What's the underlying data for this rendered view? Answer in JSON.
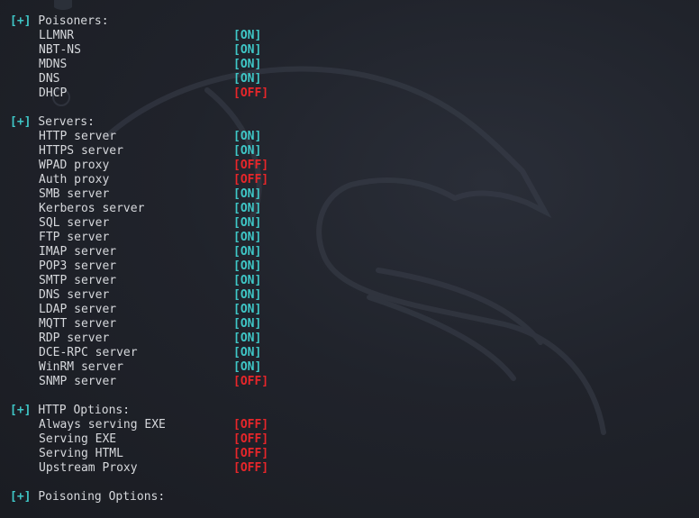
{
  "theme": {
    "on_color": "#3fc7c7",
    "off_color": "#e8262a",
    "text_color": "#d6d8dc",
    "background": "#1c1f26"
  },
  "sections": [
    {
      "marker": "[+]",
      "title": "Poisoners:",
      "items": [
        {
          "label": "LLMNR",
          "status": "[ON]"
        },
        {
          "label": "NBT-NS",
          "status": "[ON]"
        },
        {
          "label": "MDNS",
          "status": "[ON]"
        },
        {
          "label": "DNS",
          "status": "[ON]"
        },
        {
          "label": "DHCP",
          "status": "[OFF]"
        }
      ]
    },
    {
      "marker": "[+]",
      "title": "Servers:",
      "items": [
        {
          "label": "HTTP server",
          "status": "[ON]"
        },
        {
          "label": "HTTPS server",
          "status": "[ON]"
        },
        {
          "label": "WPAD proxy",
          "status": "[OFF]"
        },
        {
          "label": "Auth proxy",
          "status": "[OFF]"
        },
        {
          "label": "SMB server",
          "status": "[ON]"
        },
        {
          "label": "Kerberos server",
          "status": "[ON]"
        },
        {
          "label": "SQL server",
          "status": "[ON]"
        },
        {
          "label": "FTP server",
          "status": "[ON]"
        },
        {
          "label": "IMAP server",
          "status": "[ON]"
        },
        {
          "label": "POP3 server",
          "status": "[ON]"
        },
        {
          "label": "SMTP server",
          "status": "[ON]"
        },
        {
          "label": "DNS server",
          "status": "[ON]"
        },
        {
          "label": "LDAP server",
          "status": "[ON]"
        },
        {
          "label": "MQTT server",
          "status": "[ON]"
        },
        {
          "label": "RDP server",
          "status": "[ON]"
        },
        {
          "label": "DCE-RPC server",
          "status": "[ON]"
        },
        {
          "label": "WinRM server",
          "status": "[ON]"
        },
        {
          "label": "SNMP server",
          "status": "[OFF]"
        }
      ]
    },
    {
      "marker": "[+]",
      "title": "HTTP Options:",
      "items": [
        {
          "label": "Always serving EXE",
          "status": "[OFF]"
        },
        {
          "label": "Serving EXE",
          "status": "[OFF]"
        },
        {
          "label": "Serving HTML",
          "status": "[OFF]"
        },
        {
          "label": "Upstream Proxy",
          "status": "[OFF]"
        }
      ]
    },
    {
      "marker": "[+]",
      "title": "Poisoning Options:",
      "items": []
    }
  ]
}
